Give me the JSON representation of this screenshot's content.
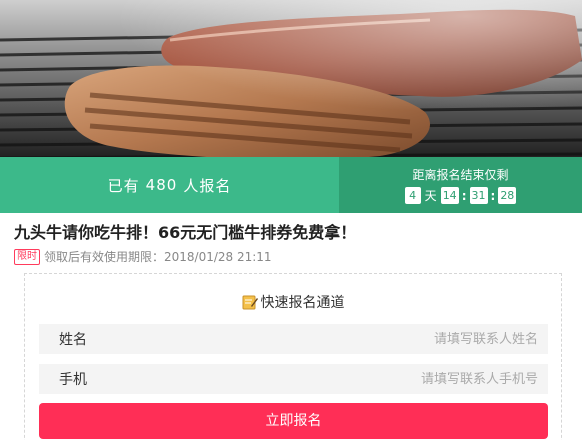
{
  "banner": {
    "image": "grilled-steak-photo",
    "signup_prefix": "已有",
    "signup_count": "480",
    "signup_suffix": "人报名",
    "countdown_label": "距离报名结束仅剩",
    "countdown": {
      "days": "4",
      "days_unit": "天",
      "hours": "14",
      "minutes": "31",
      "seconds": "28"
    }
  },
  "offer": {
    "title": "九头牛请你吃牛排！66元无门槛牛排券免费拿！",
    "limit_tag": "限时",
    "validity": "领取后有效使用期限：2018/01/28 21:11"
  },
  "form": {
    "header": "快速报名通道",
    "header_icon": "edit-icon",
    "name_label": "姓名",
    "name_placeholder": "请填写联系人姓名",
    "phone_label": "手机",
    "phone_placeholder": "请填写联系人手机号",
    "submit_label": "立即报名"
  },
  "colors": {
    "green_left": "#3cb98a",
    "green_right": "#2f9f72",
    "accent_red": "#ff2e56"
  }
}
